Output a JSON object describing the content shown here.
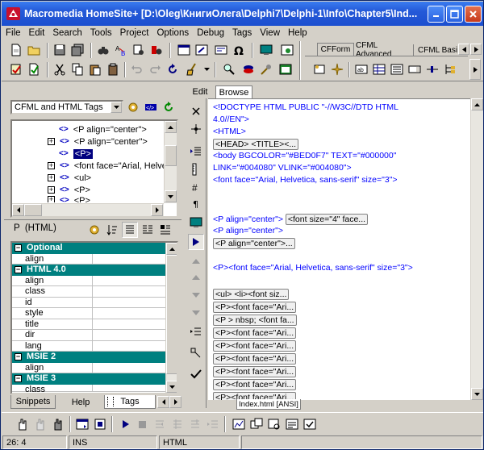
{
  "window": {
    "title": "Macromedia HomeSite+ [D:\\Oleg\\КнигиОлега\\Delphi7\\Delphi-1\\Info\\Chapter5\\Ind..."
  },
  "menu": [
    "File",
    "Edit",
    "Search",
    "Tools",
    "Project",
    "Options",
    "Debug",
    "Tags",
    "View",
    "Help"
  ],
  "toolbar_tabs": {
    "cfform": "CFForm",
    "cfml_advanced": "CFML Advanced",
    "cfml_basic": "CFML Basi"
  },
  "left": {
    "tag_filter": "CFML and HTML Tags",
    "tree_items": [
      "<P align=\"center\">",
      "<P align=\"center\">",
      "<P>",
      "<font face=\"Arial, Helve",
      "<ul>",
      "<P>",
      "<P>"
    ],
    "inspector_title": "P  (HTML)",
    "properties": [
      {
        "group": true,
        "name": "Optional"
      },
      {
        "name": "align"
      },
      {
        "group": true,
        "name": "HTML 4.0"
      },
      {
        "name": "align"
      },
      {
        "name": "class"
      },
      {
        "name": "id"
      },
      {
        "name": "style"
      },
      {
        "name": "title"
      },
      {
        "name": "dir"
      },
      {
        "name": "lang"
      },
      {
        "group": true,
        "name": "MSIE 2"
      },
      {
        "name": "align"
      },
      {
        "group": true,
        "name": "MSIE 3"
      },
      {
        "name": "class"
      }
    ],
    "tabs": {
      "snippets": "Snippets",
      "help": "Help",
      "tags": "Tags"
    }
  },
  "editor": {
    "tabs": {
      "edit": "Edit",
      "browse": "Browse"
    },
    "lines": [
      {
        "t": "<!DOCTYPE HTML PUBLIC \"-//W3C//DTD HTML"
      },
      {
        "t": "4.0//EN\">"
      },
      {
        "t": "<HTML>"
      },
      {
        "chip": "<HEAD> <TITLE><..."
      },
      {
        "t": "<body BGCOLOR=\"#BED0F7\" TEXT=\"#000000\""
      },
      {
        "t": "LINK=\"#004080\" VLINK=\"#004080\">"
      },
      {
        "t": "<font face=\"Arial, Helvetica, sans-serif\" size=\"3\">"
      },
      {
        "t": "<P align=\"center\">",
        "chip2": "<font size=\"4\" face..."
      },
      {
        "t": "<P align=\"center\">"
      },
      {
        "chip": "<P align=\"center\">..."
      },
      {
        "t": "<P><font face=\"Arial, Helvetica, sans-serif\" size=\"3\">"
      },
      {
        "chip": "<ul>   <li><font siz..."
      },
      {
        "chip": "<P><font face=\"Ari..."
      },
      {
        "chip": "<P > nbsp; <font fa..."
      },
      {
        "chip": "<P><font face=\"Ari..."
      },
      {
        "chip": "<P><font face=\"Ari..."
      },
      {
        "chip": "<P><font face=\"Ari..."
      },
      {
        "chip": "<P><font face=\"Ari..."
      },
      {
        "chip": "<P><font face=\"Ari..."
      },
      {
        "chip": "<P><font face=\"Ari..."
      }
    ],
    "file_tab": "Index.html [ANSI]"
  },
  "status": {
    "position": "26: 4",
    "mode": "INS",
    "type": "HTML"
  }
}
